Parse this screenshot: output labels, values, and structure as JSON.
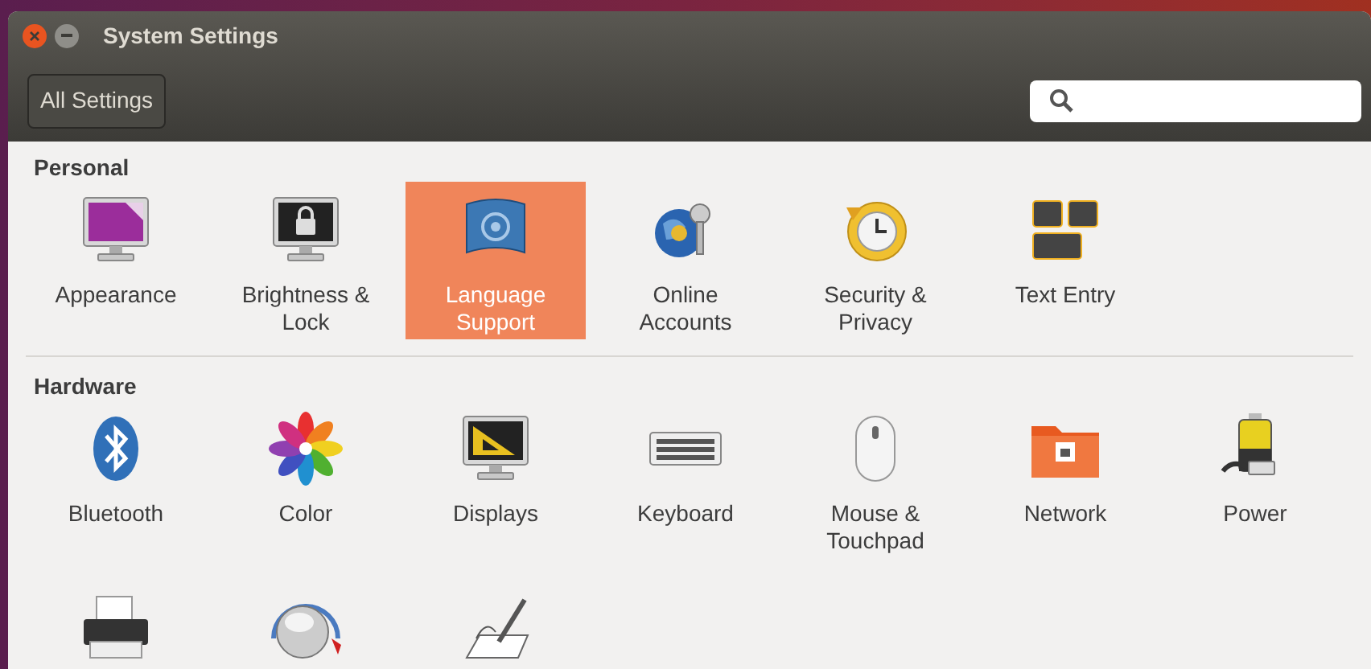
{
  "window": {
    "title": "System Settings"
  },
  "toolbar": {
    "all_settings_button": "All Settings"
  },
  "sections": [
    {
      "title": "Personal",
      "items": [
        {
          "label": "Appearance",
          "selected": false
        },
        {
          "label": "Brightness & Lock",
          "selected": false
        },
        {
          "label": "Language Support",
          "selected": true
        },
        {
          "label": "Online Accounts",
          "selected": false
        },
        {
          "label": "Security & Privacy",
          "selected": false
        },
        {
          "label": "Text Entry",
          "selected": false
        }
      ]
    },
    {
      "title": "Hardware",
      "items": [
        {
          "label": "Bluetooth",
          "selected": false
        },
        {
          "label": "Color",
          "selected": false
        },
        {
          "label": "Displays",
          "selected": false
        },
        {
          "label": "Keyboard",
          "selected": false
        },
        {
          "label": "Mouse & Touchpad",
          "selected": false
        },
        {
          "label": "Network",
          "selected": false
        },
        {
          "label": "Power",
          "selected": false
        },
        {
          "selected": false
        },
        {
          "selected": false
        },
        {
          "selected": false
        }
      ]
    }
  ]
}
